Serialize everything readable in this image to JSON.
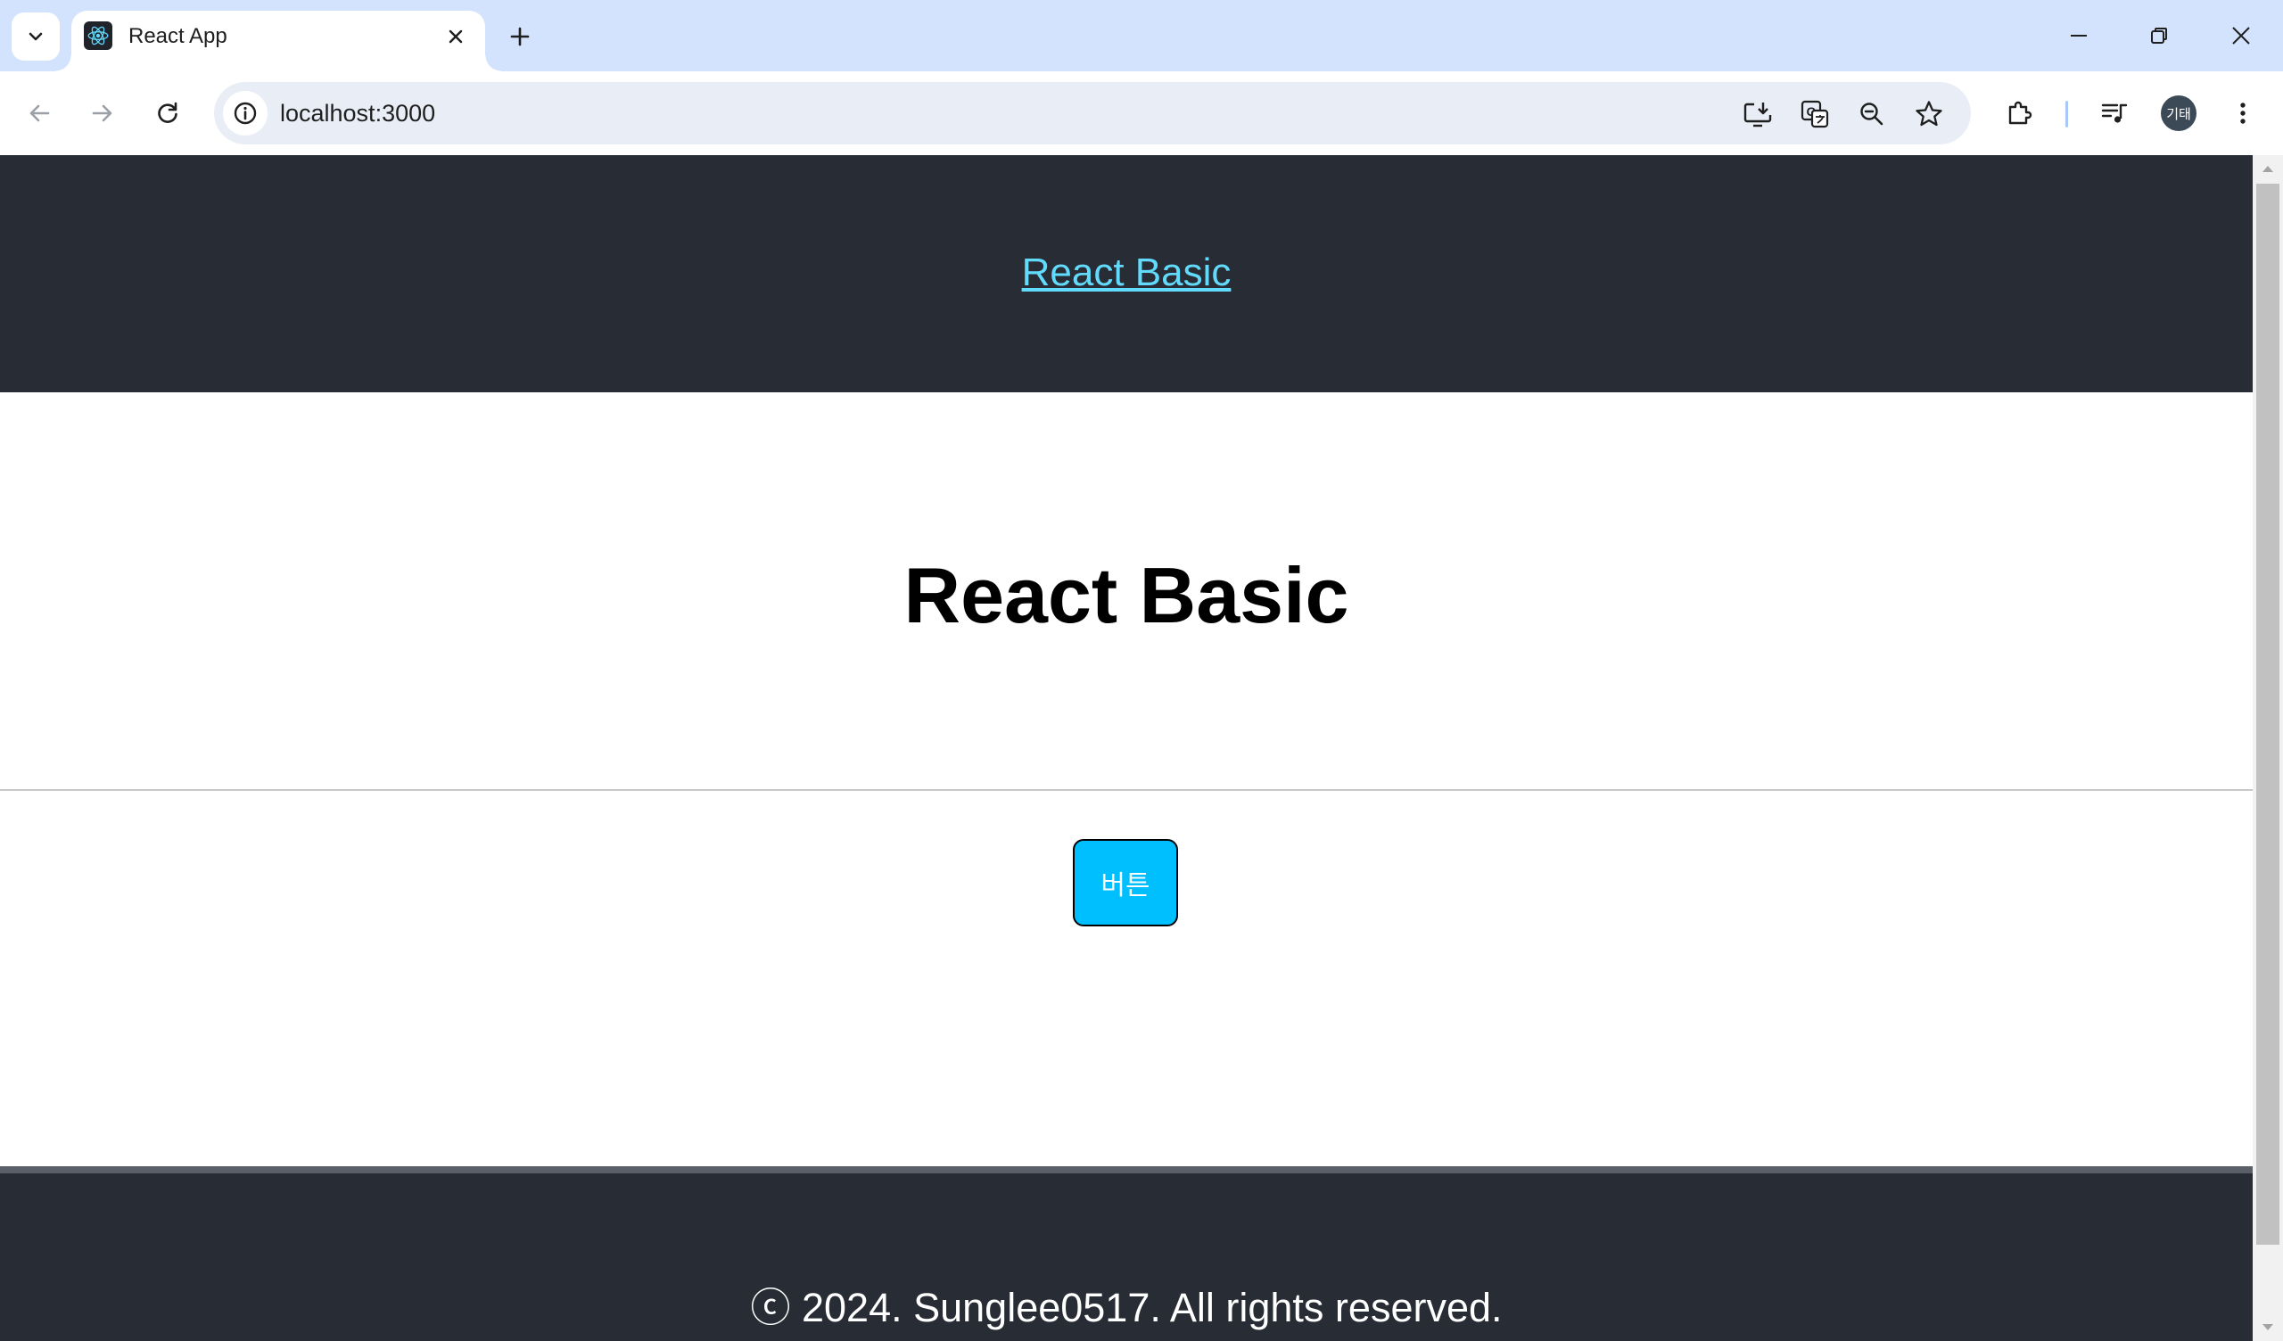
{
  "browser": {
    "tab": {
      "title": "React App"
    },
    "address_bar": {
      "url": "localhost:3000"
    },
    "profile": {
      "initials": "기태"
    }
  },
  "page": {
    "header": {
      "link_text": "React Basic"
    },
    "main": {
      "title": "React Basic",
      "button_label": "버튼"
    },
    "footer": {
      "text": "ⓒ 2024. Sunglee0517. All rights reserved."
    }
  },
  "colors": {
    "header_bg": "#282c34",
    "link": "#61dafb",
    "button_bg": "#00bfff",
    "footer_bg": "#282c34"
  }
}
